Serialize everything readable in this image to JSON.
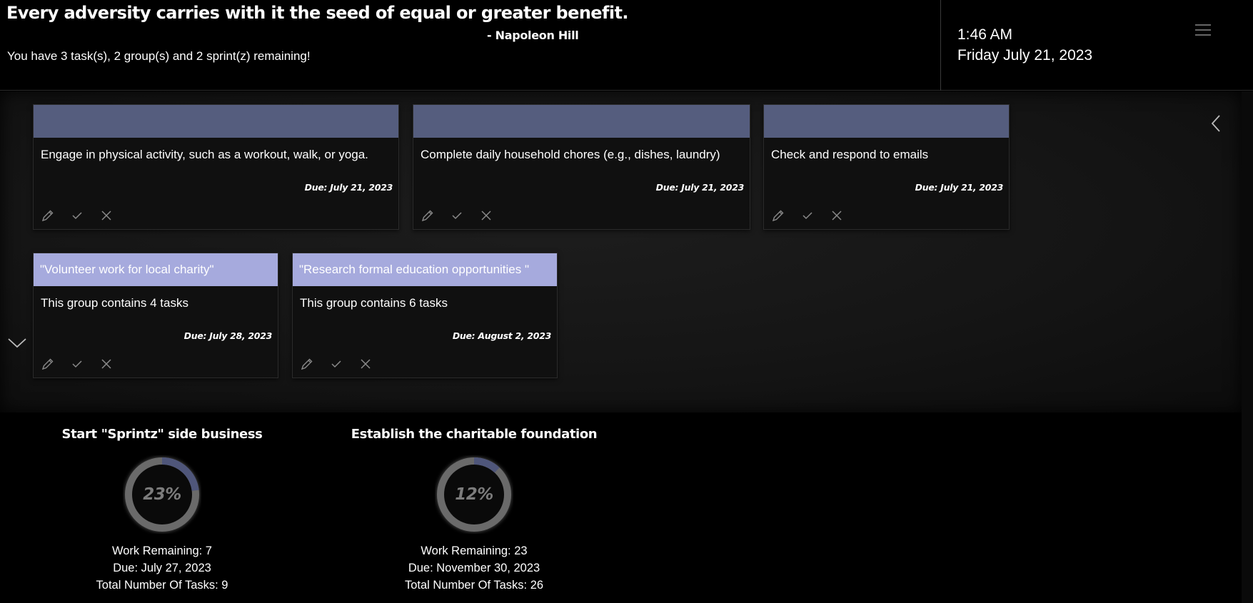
{
  "header": {
    "quote": "Every adversity carries with it the seed of equal or greater benefit.",
    "author": "- Napoleon Hill",
    "remaining": "You have 3 task(s), 2 group(s) and 2 sprint(z) remaining!",
    "time": "1:46 AM",
    "date": "Friday July 21, 2023",
    "menu_icon": "hamburger-menu-icon"
  },
  "tasks": [
    {
      "header": "",
      "title": "Engage in physical activity, such as a workout, walk, or yoga.",
      "due": "Due: July 21, 2023"
    },
    {
      "header": "",
      "title": "Complete daily household chores (e.g., dishes, laundry)",
      "due": "Due: July 21, 2023"
    },
    {
      "header": "",
      "title": "Check and respond to emails",
      "due": "Due: July 21, 2023"
    }
  ],
  "groups": [
    {
      "header": "\"Volunteer work for local charity\"",
      "title": "This group contains 4 tasks",
      "due": "Due: July 28, 2023"
    },
    {
      "header": "\"Research formal education opportunities \"",
      "title": "This group contains 6 tasks",
      "due": "Due: August 2, 2023"
    }
  ],
  "colors": {
    "task_header": "#555d7e",
    "group_header": "#a6aadd",
    "progress_fill": "#4f567a",
    "progress_track": "#6a6a6a"
  },
  "sprints": [
    {
      "title": "Start \"Sprintz\" side business",
      "percent_label": "23%",
      "progress": 0.23,
      "work_remaining": "Work Remaining: 7",
      "due": "Due: July 27, 2023",
      "total_tasks": "Total Number Of Tasks: 9"
    },
    {
      "title": "Establish the charitable foundation",
      "percent_label": "12%",
      "progress": 0.12,
      "work_remaining": "Work Remaining: 23",
      "due": "Due: November 30, 2023",
      "total_tasks": "Total Number Of Tasks: 26"
    }
  ]
}
